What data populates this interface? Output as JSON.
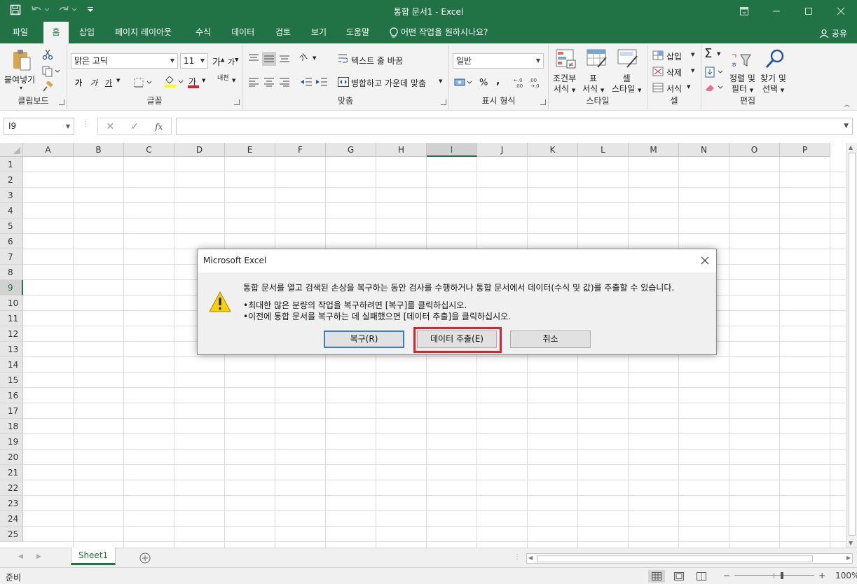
{
  "window": {
    "title": "통합 문서1  -  Excel"
  },
  "tabs": [
    "파일",
    "홈",
    "삽입",
    "페이지 레이아웃",
    "수식",
    "데이터",
    "검토",
    "보기",
    "도움말"
  ],
  "tell_me": "어떤 작업을 원하시나요?",
  "share": "공유",
  "ribbon": {
    "clipboard": {
      "paste": "붙여넣기",
      "label": "클립보드"
    },
    "font": {
      "name": "맑은 고딕",
      "size": "11",
      "label": "글꼴",
      "grow": "가",
      "shrink": "가",
      "bold": "가",
      "italic": "가",
      "underline": "가",
      "color_letter": "가",
      "phonetic": "내천"
    },
    "alignment": {
      "wrap": "텍스트 줄 바꿈",
      "merge": "병합하고 가운데 맞춤",
      "label": "맞춤",
      "orient": "가"
    },
    "number": {
      "format": "일반",
      "label": "표시 형식",
      "percent": "%",
      "comma": ","
    },
    "styles": {
      "cond1": "조건부",
      "cond2": "서식",
      "table1": "표",
      "table2": "서식",
      "cell1": "셀",
      "cell2": "스타일",
      "label": "스타일"
    },
    "cells": {
      "insert": "삽입",
      "delete": "삭제",
      "format": "서식",
      "label": "셀"
    },
    "editing": {
      "sort1": "정렬 및",
      "sort2": "필터",
      "find1": "찾기 및",
      "find2": "선택",
      "label": "편집"
    }
  },
  "formula_bar": {
    "name_box": "I9",
    "fx": "fx"
  },
  "columns": [
    "A",
    "B",
    "C",
    "D",
    "E",
    "F",
    "G",
    "H",
    "I",
    "J",
    "K",
    "L",
    "M",
    "N",
    "O",
    "P"
  ],
  "rows": [
    "1",
    "2",
    "3",
    "4",
    "5",
    "6",
    "7",
    "8",
    "9",
    "10",
    "11",
    "12",
    "13",
    "14",
    "15",
    "16",
    "17",
    "18",
    "19",
    "20",
    "21",
    "22",
    "23",
    "24",
    "25"
  ],
  "selected": {
    "col": "I",
    "row": "9"
  },
  "sheet": {
    "tab": "Sheet1"
  },
  "status": {
    "ready": "준비",
    "zoom": "100%"
  },
  "dialog": {
    "title": "Microsoft Excel",
    "line1": "통합 문서를 열고 검색된 손상을 복구하는 동안 검사를 수행하거나 통합 문서에서 데이터(수식 및 값)를 추출할 수 있습니다.",
    "line2": "•최대한 많은 분량의 작업을 복구하려면 [복구]를 클릭하십시오.",
    "line3": "•이전에 통합 문서를 복구하는 데 실패했으면 [데이터 추출]을 클릭하십시오.",
    "repair": "복구(R)",
    "extract": "데이터 추출(E)",
    "cancel": "취소"
  },
  "colors": {
    "excel_green": "#217346",
    "highlight": "#e0202f"
  }
}
